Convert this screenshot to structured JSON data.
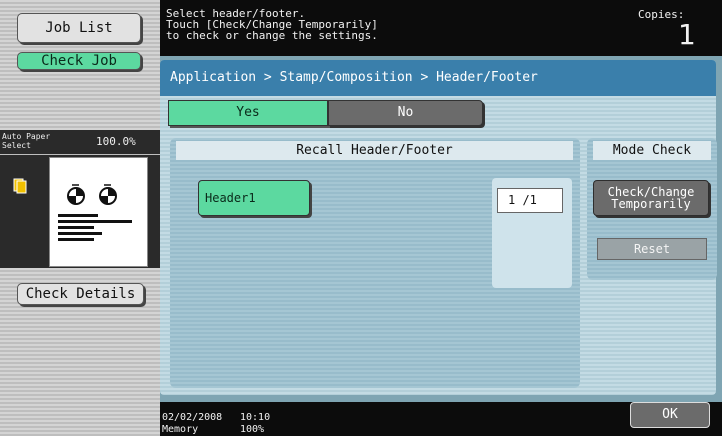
{
  "left_panel": {
    "job_list_label": "Job List",
    "check_job_label": "Check Job",
    "paper_select_line1": "Auto Paper",
    "paper_select_line2": "Select",
    "zoom": "100.0%",
    "check_details_label": "Check Details"
  },
  "message": {
    "line1": "Select header/footer.",
    "line2": "Touch [Check/Change Temporarily]",
    "line3": "to check or change the settings.",
    "copies_label": "Copies:",
    "copies_value": "1"
  },
  "breadcrumb": "Application > Stamp/Composition > Header/Footer",
  "tabs": {
    "yes": "Yes",
    "no": "No"
  },
  "recall": {
    "title": "Recall Header/Footer",
    "header_button": "Header1",
    "page_counter": "1 /1"
  },
  "mode_check": {
    "title": "Mode Check",
    "check_change_line1": "Check/Change",
    "check_change_line2": "Temporarily",
    "reset": "Reset"
  },
  "status": {
    "date": "02/02/2008",
    "time": "10:10",
    "memory_label": "Memory",
    "memory_value": "100%"
  },
  "ok_label": "OK",
  "colors": {
    "accent_green": "#5cd9a0",
    "breadcrumb_blue": "#3a7fab",
    "panel_blue": "#c3dbe4"
  },
  "icons": [
    "staple-icon",
    "page-preview-icon",
    "punch-hole-icon"
  ]
}
